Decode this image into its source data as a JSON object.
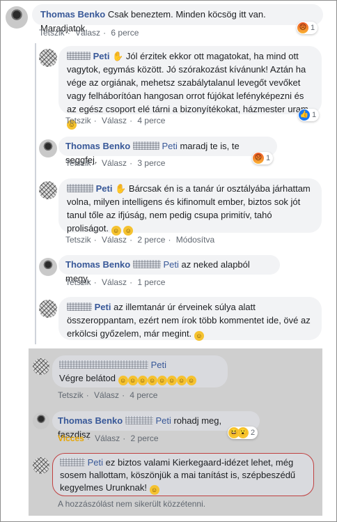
{
  "top": {
    "name": "Thomas Benko",
    "text": "Csak beneztem. Minden köcsög itt van. Maradjatok.",
    "actions": [
      "Tetszik",
      "Válasz",
      "6 perce"
    ],
    "react_count": "1"
  },
  "replies": [
    {
      "name": "Peti",
      "text": "Jól érzitek ekkor ott magatokat, ha mind ott vagytok, egymás között. Jó szórakozást kívánunk! Aztán ha vége az orgiának, mehetsz szabálytalanul levegőt vevőket vagy felháborítóan hangosan orrot fújókat lefényképezni és az egész csoport elé tárni a bizonyítékokat, házmester uram.",
      "actions": [
        "Tetszik",
        "Válasz",
        "4 perce"
      ],
      "react_count": "1"
    },
    {
      "name": "Thomas Benko",
      "mention": "Peti",
      "text": "maradj te is, te seggfej.",
      "actions": [
        "Tetszik",
        "Válasz",
        "3 perce"
      ],
      "react_count": "1"
    },
    {
      "name": "Peti",
      "text": "Bárcsak én is a tanár úr osztályába járhattam volna, milyen intelligens és kifinomult ember, biztos sok jót tanul tőle az ifjúság, nem pedig csupa primitív, tahó proliságot.",
      "actions": [
        "Tetszik",
        "Válasz",
        "2 perce",
        "Módosítva"
      ]
    },
    {
      "name": "Thomas Benko",
      "mention": "Peti",
      "text": "az neked alapból megy,",
      "actions": [
        "Tetszik",
        "Válasz",
        "1 perce"
      ]
    },
    {
      "name": "Peti",
      "text": "az illemtanár úr érveinek súlya alatt összeroppantam, ezért nem írok több kommentet ide, övé az erkölcsi győzelem, már megint."
    }
  ],
  "gray": {
    "c1": {
      "mention": "Peti",
      "text": "Végre belátod",
      "actions": [
        "Tetszik",
        "Válasz",
        "4 perce"
      ]
    },
    "c2": {
      "name": "Thomas Benko",
      "mention": "Peti",
      "text": "rohadj meg, faszdisz",
      "actions": [
        "Vicces",
        "Válasz",
        "2 perce"
      ],
      "react_count": "2"
    },
    "c3": {
      "mention": "Peti",
      "text": "ez biztos valami Kierkegaard-idézet lehet, még sosem hallottam, köszönjük a mai tanítást is, szépbeszédű kegyelmes Urunknak!"
    },
    "error": "A hozzászólást nem sikerült közzétenni."
  },
  "icons": {
    "angry": "angry-reaction-icon",
    "like": "like-reaction-icon",
    "wow": "wow-reaction-icon",
    "haha": "haha-reaction-icon"
  },
  "colors": {
    "name": "#385898",
    "bubble": "#f2f3f5",
    "meta": "#606770",
    "vicces": "#e7a500",
    "error_border": "#c04040"
  }
}
